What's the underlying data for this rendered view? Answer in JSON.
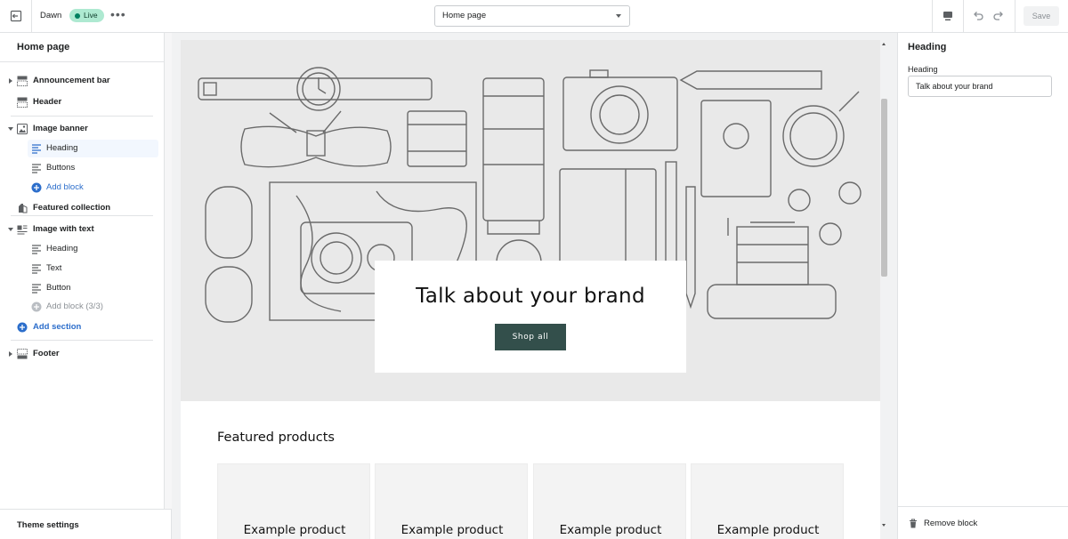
{
  "topbar": {
    "theme_name": "Dawn",
    "live_badge": "Live",
    "more_icon": "more-horizontal-icon",
    "page_select": "Home page",
    "save_label": "Save"
  },
  "left": {
    "title": "Home page",
    "sections": {
      "announcement_bar": "Announcement bar",
      "header": "Header",
      "image_banner": "Image banner",
      "banner_heading": "Heading",
      "banner_buttons": "Buttons",
      "banner_add_block": "Add block",
      "featured_collection": "Featured collection",
      "image_with_text": "Image with text",
      "iwt_heading": "Heading",
      "iwt_text": "Text",
      "iwt_button": "Button",
      "iwt_add_block": "Add block (3/3)",
      "add_section": "Add section",
      "footer": "Footer"
    },
    "theme_settings": "Theme settings"
  },
  "preview": {
    "hero_heading": "Talk about your brand",
    "hero_button": "Shop all",
    "featured_title": "Featured products",
    "products": [
      "Example product",
      "Example product",
      "Example product",
      "Example product"
    ]
  },
  "right": {
    "title": "Heading",
    "field_label": "Heading",
    "field_value": "Talk about your brand",
    "remove_block": "Remove block"
  },
  "colors": {
    "accent_blue": "#2c6ecb",
    "live_green": "#aee9d1",
    "hero_button": "#334f4b"
  }
}
